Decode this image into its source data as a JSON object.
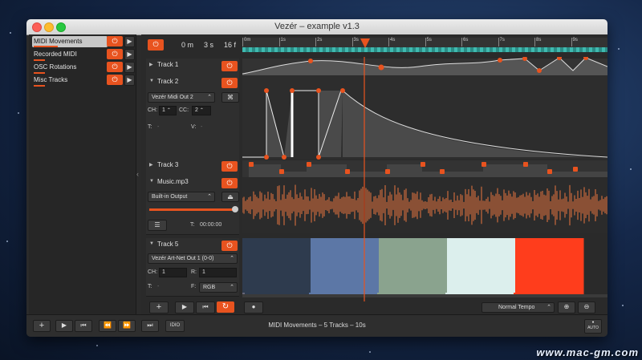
{
  "window": {
    "title": "Vezér – example v1.3"
  },
  "sidebar": {
    "items": [
      {
        "label": "MIDI Movements"
      },
      {
        "label": "Recorded MIDI"
      },
      {
        "label": "OSC Rotations"
      },
      {
        "label": "Misc Tracks"
      }
    ]
  },
  "transport_header": {
    "minutes": "0",
    "minutes_unit": "m",
    "seconds": "3",
    "seconds_unit": "s",
    "frames": "16",
    "frames_unit": "f"
  },
  "timeline": {
    "ticks": [
      "0m",
      "1s",
      "2s",
      "3s",
      "4s",
      "5s",
      "6s",
      "7s",
      "8s",
      "9s",
      "1("
    ]
  },
  "tracks": {
    "track1": {
      "name": "Track 1"
    },
    "track2": {
      "name": "Track 2",
      "output": "Vezér Midi Out 2",
      "ch_label": "CH:",
      "ch_value": "1",
      "cc_label": "CC:",
      "cc_value": "2",
      "t_label": "T:",
      "t_value": "-",
      "v_label": "V:",
      "v_value": "-"
    },
    "track3": {
      "name": "Track 3"
    },
    "music": {
      "name": "Music.mp3",
      "output": "Built-in Output",
      "volume": 1.0,
      "t_label": "T:",
      "t_value": "00:00:00"
    },
    "track5": {
      "name": "Track 5",
      "output": "Vezér Art-Net Out 1 (0-0)",
      "ch_label": "CH:",
      "ch_value": "1",
      "r_label": "R:",
      "r_value": "1",
      "t_label": "T:",
      "t_value": "-",
      "f_label": "F:",
      "f_value": "RGB"
    }
  },
  "color_track": {
    "colors": [
      "#2e3b4e",
      "#5c77a6",
      "#8aa38e",
      "#dcefed",
      "#ff3d1c"
    ]
  },
  "main_toolbar": {
    "tempo": "Normal Tempo"
  },
  "status": {
    "text": "MIDI Movements – 5 Tracks – 10s",
    "auto": "AUTO",
    "midi_in_label": "IDIO"
  },
  "watermark": "www.mac-gm.com",
  "colors": {
    "accent": "#e8531f",
    "bg": "#2b2b2b"
  }
}
